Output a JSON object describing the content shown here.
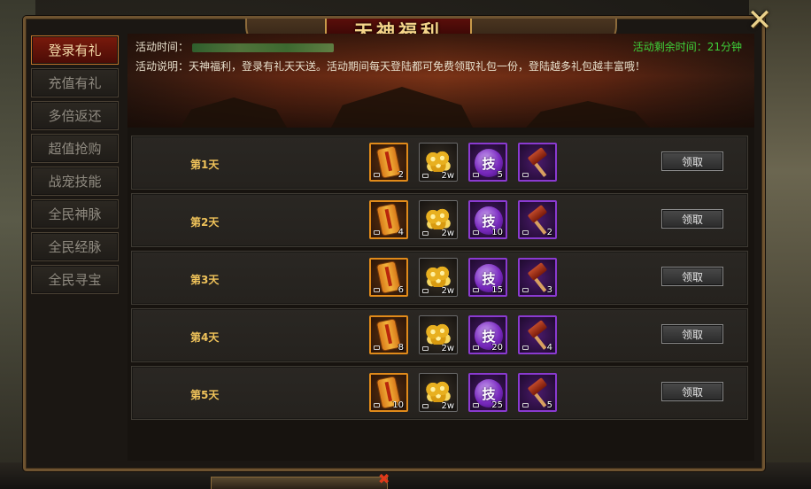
{
  "title": "天神福利",
  "sidebar": {
    "tabs": [
      "登录有礼",
      "充值有礼",
      "多倍返还",
      "超值抢购",
      "战宠技能",
      "全民神脉",
      "全民经脉",
      "全民寻宝"
    ],
    "active_index": 0
  },
  "banner": {
    "time_label": "活动时间：",
    "remaining": "活动剩余时间：21分钟",
    "description": "活动说明：天神福利，登录有礼天天送。活动期间每天登陆都可免费领取礼包一份，登陆越多礼包越丰富哦！"
  },
  "item_icons": [
    "scroll-icon",
    "gold-coins-icon",
    "skill-book-icon",
    "hammer-icon"
  ],
  "skill_glyph": "技",
  "rows": [
    {
      "day": "第1天",
      "quantities": [
        "2",
        "2w",
        "5",
        ""
      ],
      "claim_label": "领取"
    },
    {
      "day": "第2天",
      "quantities": [
        "4",
        "2w",
        "10",
        "2"
      ],
      "claim_label": "领取"
    },
    {
      "day": "第3天",
      "quantities": [
        "6",
        "2w",
        "15",
        "3"
      ],
      "claim_label": "领取"
    },
    {
      "day": "第4天",
      "quantities": [
        "8",
        "2w",
        "20",
        "4"
      ],
      "claim_label": "领取"
    },
    {
      "day": "第5天",
      "quantities": [
        "10",
        "2w",
        "25",
        "5"
      ],
      "claim_label": "领取"
    }
  ],
  "colors": {
    "accent_gold": "#f0c35a",
    "remaining_green": "#3ed23a",
    "active_tab": "#7a1a0c",
    "rare_border": "#e08a1a",
    "epic_border": "#8a3ad0"
  }
}
